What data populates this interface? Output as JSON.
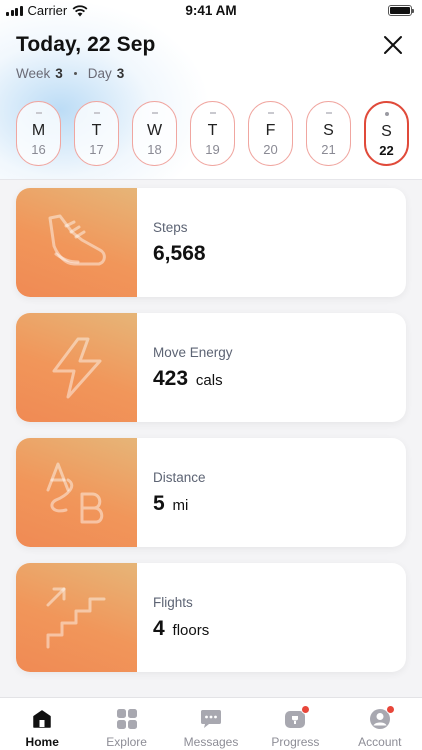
{
  "status_bar": {
    "carrier": "Carrier",
    "time": "9:41 AM"
  },
  "header": {
    "title": "Today, 22 Sep",
    "week_label": "Week",
    "week_value": "3",
    "day_label": "Day",
    "day_value": "3"
  },
  "days": [
    {
      "letter": "M",
      "num": "16",
      "active": false
    },
    {
      "letter": "T",
      "num": "17",
      "active": false
    },
    {
      "letter": "W",
      "num": "18",
      "active": false
    },
    {
      "letter": "T",
      "num": "19",
      "active": false
    },
    {
      "letter": "F",
      "num": "20",
      "active": false
    },
    {
      "letter": "S",
      "num": "21",
      "active": false
    },
    {
      "letter": "S",
      "num": "22",
      "active": true
    }
  ],
  "cards": [
    {
      "label": "Steps",
      "value": "6,568",
      "unit": "",
      "icon": "shoe-icon"
    },
    {
      "label": "Move Energy",
      "value": "423",
      "unit": "cals",
      "icon": "lightning-icon"
    },
    {
      "label": "Distance",
      "value": "5",
      "unit": "mi",
      "icon": "a-to-b-icon"
    },
    {
      "label": "Flights",
      "value": "4",
      "unit": "floors",
      "icon": "stairs-icon"
    }
  ],
  "tabs": [
    {
      "label": "Home",
      "icon": "home-icon",
      "active": true,
      "badge": false
    },
    {
      "label": "Explore",
      "icon": "grid-icon",
      "active": false,
      "badge": false
    },
    {
      "label": "Messages",
      "icon": "chat-icon",
      "active": false,
      "badge": false
    },
    {
      "label": "Progress",
      "icon": "trophy-icon",
      "active": false,
      "badge": true
    },
    {
      "label": "Account",
      "icon": "user-icon",
      "active": false,
      "badge": true
    }
  ],
  "colors": {
    "accent": "#e04a3a",
    "card_gradient_start": "#e6b578",
    "card_gradient_end": "#f08a54"
  }
}
